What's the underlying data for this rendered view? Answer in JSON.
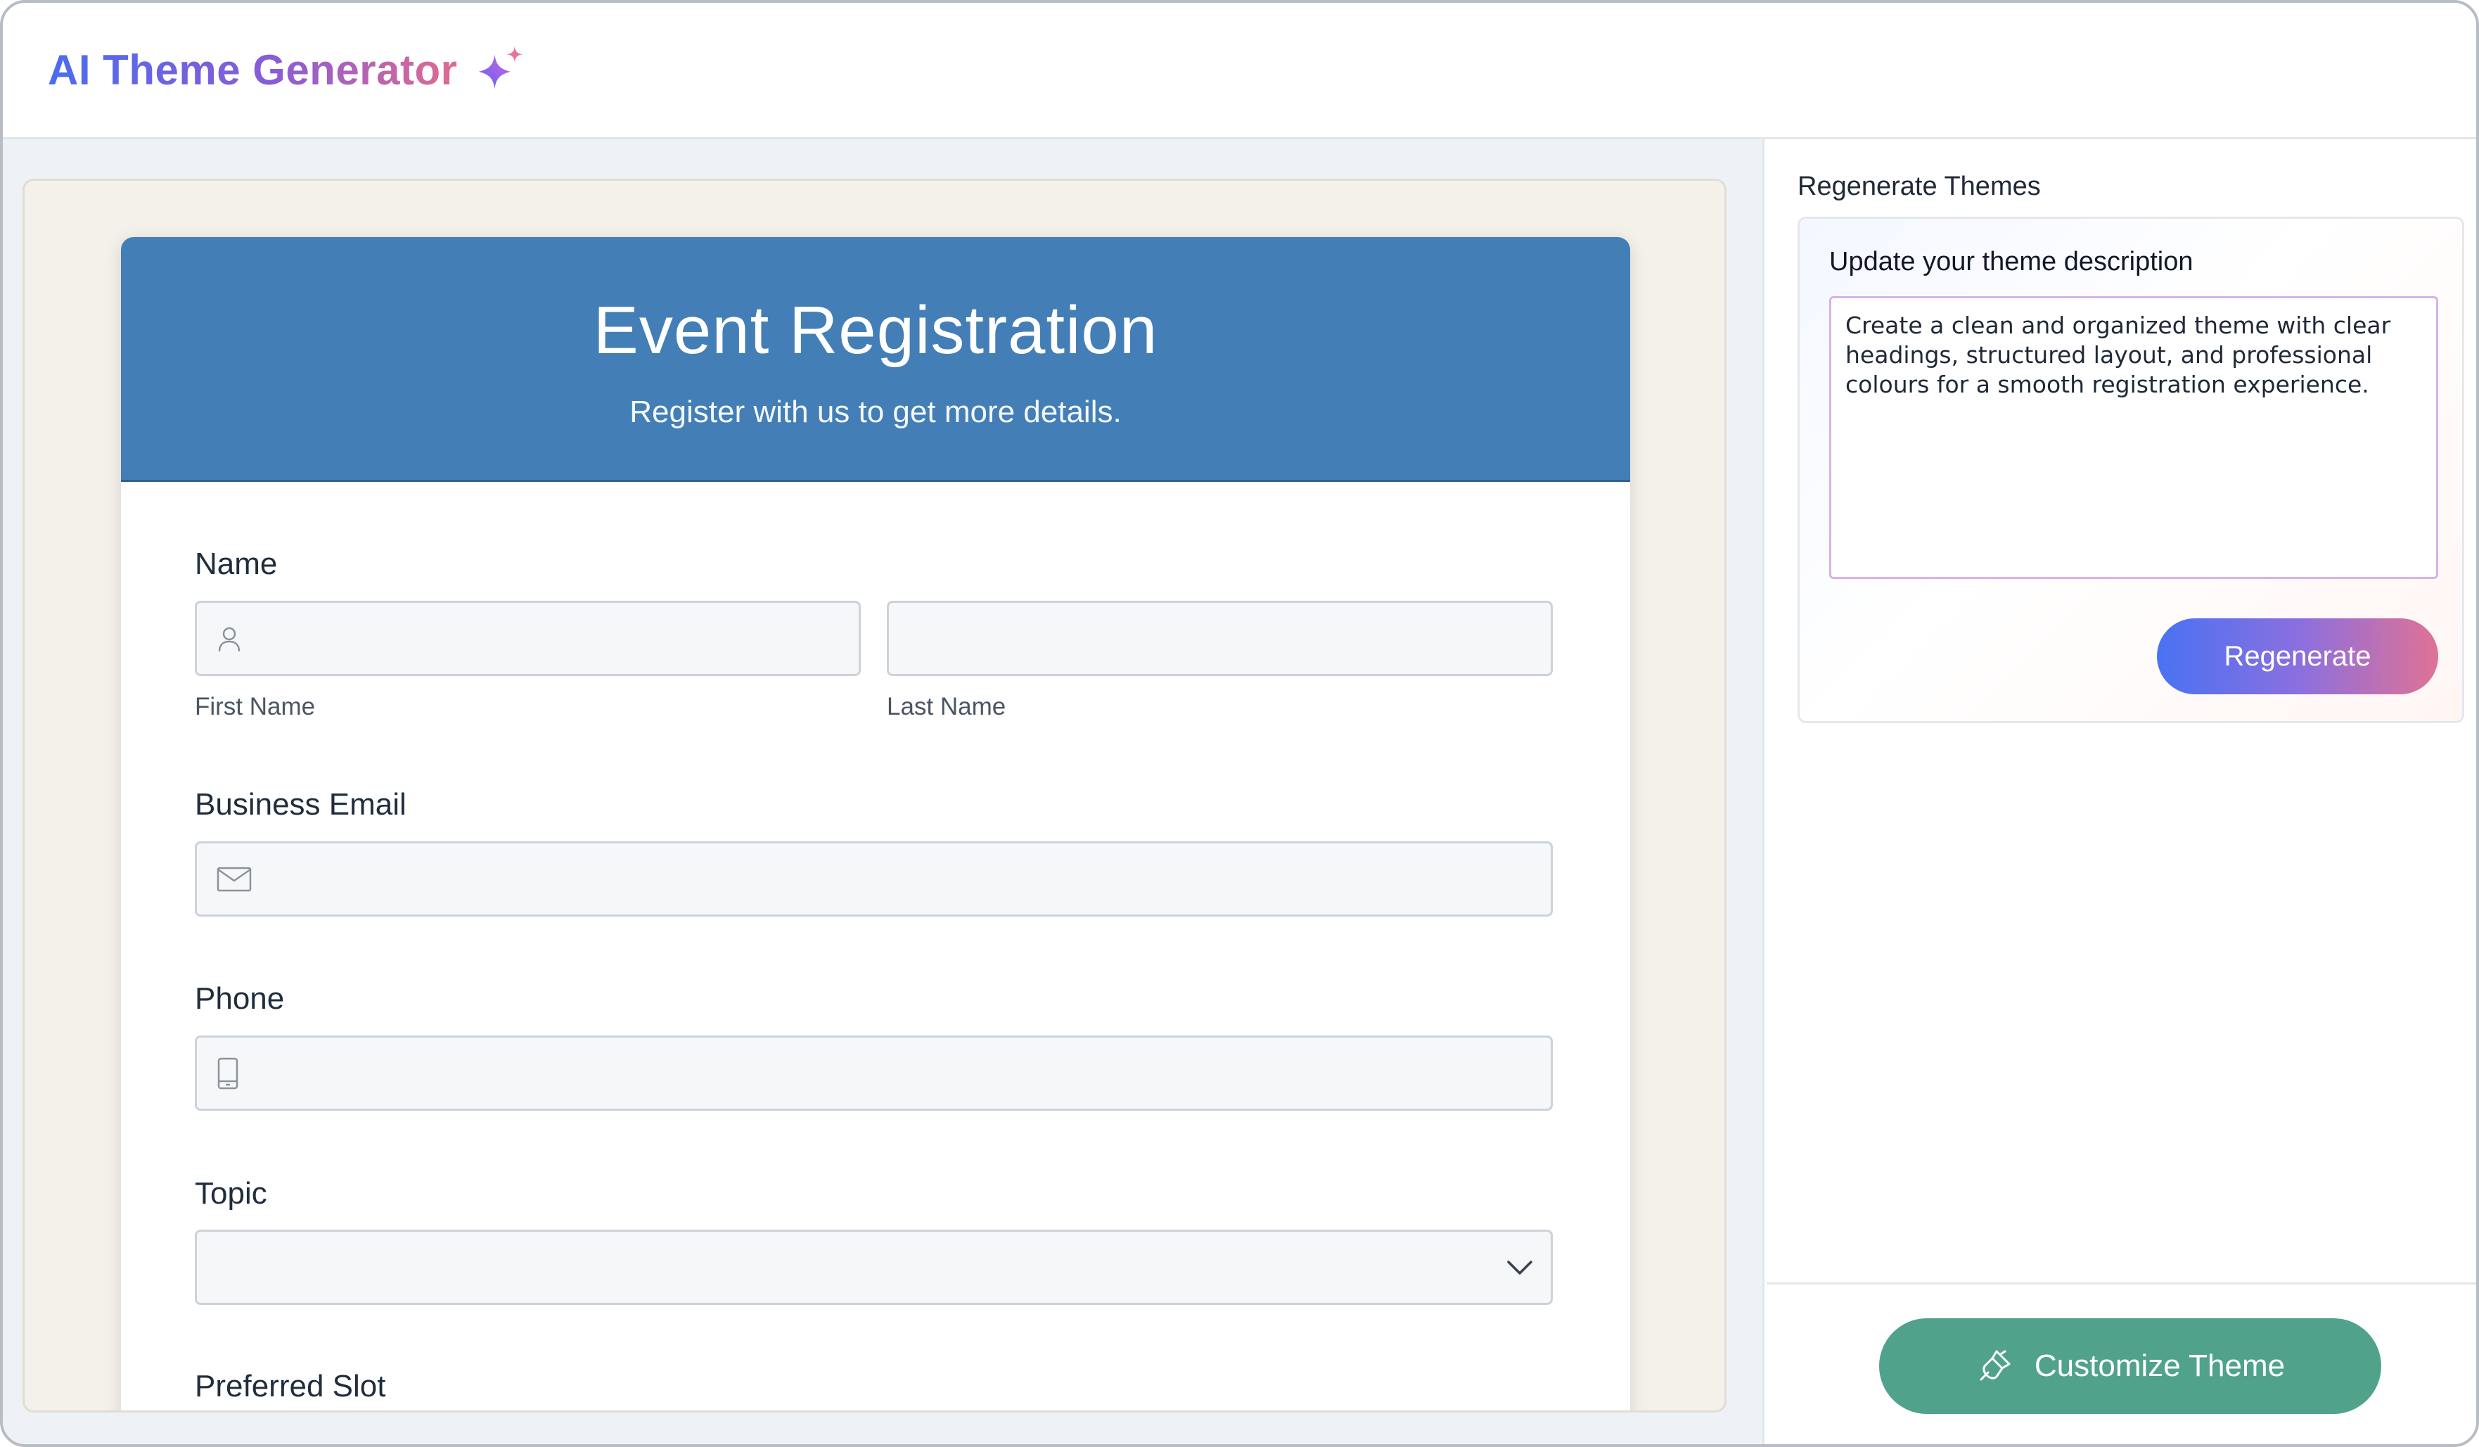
{
  "app": {
    "title": "AI Theme Generator",
    "brand_icon": "sparkle-icon",
    "brand_gradient": [
      "#4a6cf0",
      "#8a5cd6",
      "#e06b8f"
    ]
  },
  "form": {
    "title": "Event Registration",
    "subtitle": "Register with us to get more details.",
    "header_color": "#437fb6",
    "fields": {
      "name": {
        "label": "Name",
        "first_sublabel": "First Name",
        "last_sublabel": "Last Name",
        "icon": "user-icon"
      },
      "email": {
        "label": "Business Email",
        "icon": "envelope-icon"
      },
      "phone": {
        "label": "Phone",
        "icon": "mobile-phone-icon"
      },
      "topic": {
        "label": "Topic",
        "icon": "chevron-down-icon"
      },
      "slot": {
        "label": "Preferred Slot"
      }
    }
  },
  "sidebar": {
    "section_title": "Regenerate Themes",
    "card_label": "Update your theme description",
    "description": "Create a clean and organized theme with clear headings, structured layout, and professional colours for a smooth registration experience.",
    "regenerate_label": "Regenerate",
    "customize_label": "Customize Theme",
    "customize_icon": "paint-brush-icon",
    "customize_color": "#50a38a"
  }
}
